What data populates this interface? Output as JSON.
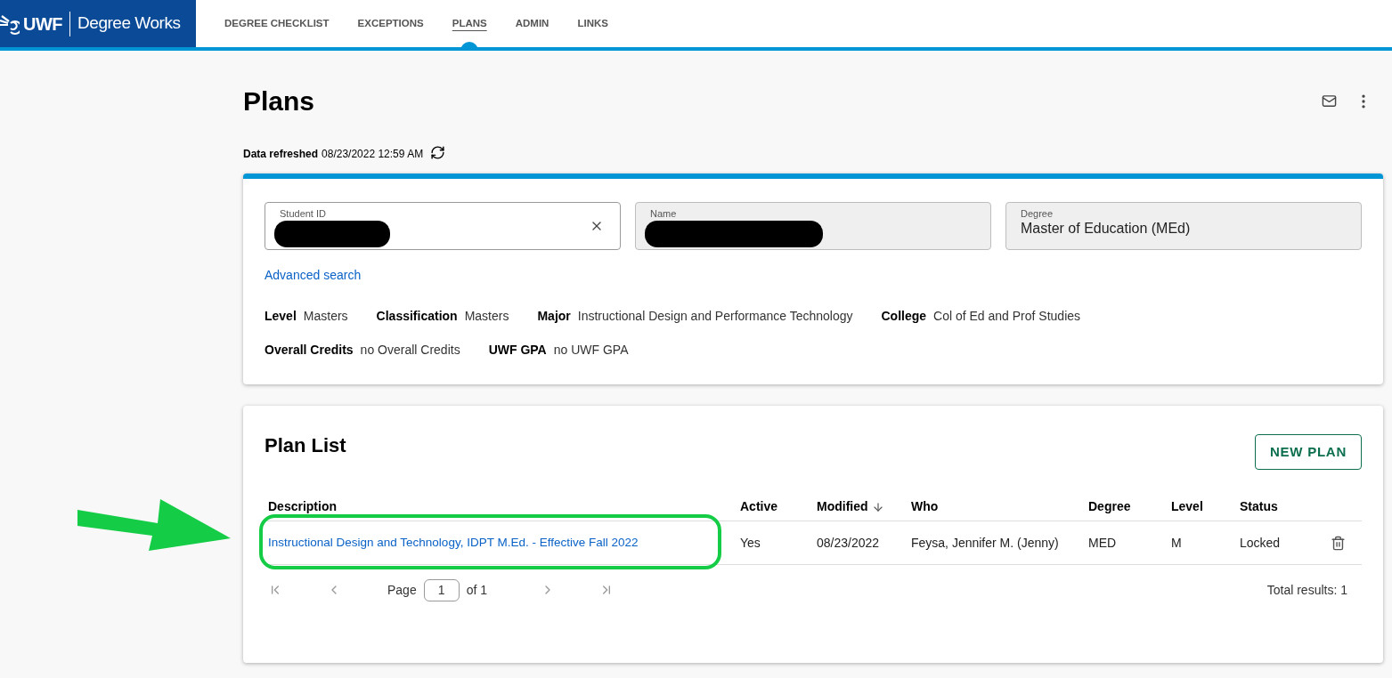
{
  "app": {
    "logo_text": "UWF",
    "title": "Degree Works"
  },
  "nav": [
    {
      "label": "DEGREE CHECKLIST",
      "selected": false
    },
    {
      "label": "EXCEPTIONS",
      "selected": false
    },
    {
      "label": "PLANS",
      "selected": true
    },
    {
      "label": "ADMIN",
      "selected": false
    },
    {
      "label": "LINKS",
      "selected": false
    }
  ],
  "page": {
    "title": "Plans",
    "refresh_label": "Data refreshed",
    "refresh_time": "08/23/2022 12:59 AM"
  },
  "student": {
    "fields": [
      {
        "label": "Student ID",
        "value_redacted": true,
        "clearable": true,
        "readonly": false
      },
      {
        "label": "Name",
        "value_redacted": true,
        "clearable": false,
        "readonly": true
      },
      {
        "label": "Degree",
        "value": "Master of Education (MEd)",
        "clearable": false,
        "readonly": true
      }
    ],
    "advanced_search": "Advanced search",
    "info_rows": [
      [
        {
          "label": "Level",
          "value": "Masters"
        },
        {
          "label": "Classification",
          "value": "Masters"
        },
        {
          "label": "Major",
          "value": "Instructional Design and Performance Technology"
        },
        {
          "label": "College",
          "value": "Col of Ed and Prof Studies"
        }
      ],
      [
        {
          "label": "Overall Credits",
          "value": "no Overall Credits"
        },
        {
          "label": "UWF GPA",
          "value": "no UWF GPA"
        }
      ]
    ]
  },
  "plan_list": {
    "title": "Plan List",
    "new_button": "NEW PLAN",
    "columns": [
      {
        "label": "Description",
        "sorted": false
      },
      {
        "label": "Active",
        "sorted": false
      },
      {
        "label": "Modified",
        "sorted": true
      },
      {
        "label": "Who",
        "sorted": false
      },
      {
        "label": "Degree",
        "sorted": false
      },
      {
        "label": "Level",
        "sorted": false
      },
      {
        "label": "Status",
        "sorted": false
      }
    ],
    "rows": [
      {
        "cells": [
          "Instructional Design and Technology, IDPT M.Ed. - Effective Fall 2022",
          "Yes",
          "08/23/2022",
          "Feysa, Jennifer M. (Jenny)",
          "MED",
          "M",
          "Locked"
        ],
        "highlighted": true
      }
    ],
    "pagination": {
      "page_label": "Page",
      "page": "1",
      "of_label": "of 1",
      "total": "Total results: 1"
    }
  }
}
